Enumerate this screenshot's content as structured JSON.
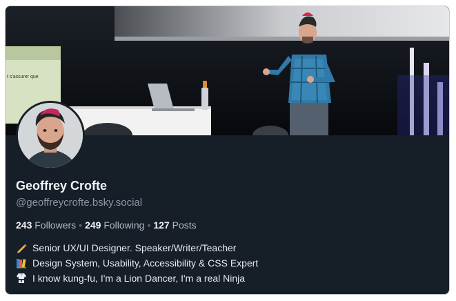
{
  "profile": {
    "display_name": "Geoffrey Crofte",
    "handle": "@geoffreycrofte.bsky.social",
    "stats": {
      "followers_count": "243",
      "followers_label": "Followers",
      "following_count": "249",
      "following_label": "Following",
      "posts_count": "127",
      "posts_label": "Posts",
      "separator": "•"
    },
    "bio": [
      {
        "icon": "pencil-icon",
        "text": "Senior UX/UI Designer. Speaker/Writer/Teacher"
      },
      {
        "icon": "books-icon",
        "text": "Design System, Usability, Accessibility & CSS Expert"
      },
      {
        "icon": "martial-arts-uniform-icon",
        "text": "I know kung-fu, I'm a Lion Dancer, I'm a real Ninja"
      }
    ],
    "banner": {
      "slide_text": "t s'assurer que"
    }
  },
  "colors": {
    "card_background": "#161e27",
    "name_text": "#f1f3f5",
    "muted_text": "#8b98a5",
    "avatar_border": "#161e27"
  }
}
